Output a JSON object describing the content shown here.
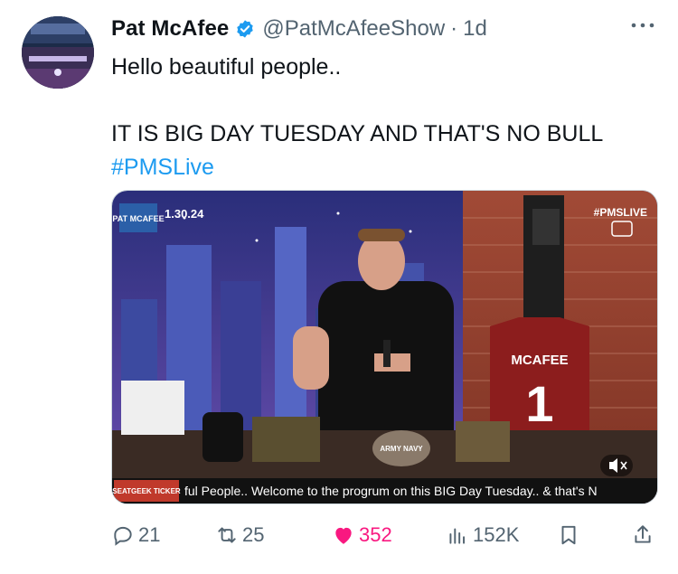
{
  "tweet": {
    "author_name": "Pat McAfee",
    "handle": "@PatMcAfeeShow",
    "separator": "·",
    "time": "1d",
    "text_line1": "Hello beautiful people..",
    "text_line2": "IT IS BIG DAY TUESDAY AND THAT'S NO BULL",
    "hashtag": "#PMSLive",
    "verified_color": "#1d9bf0"
  },
  "video": {
    "show_logo": "PAT MCAFEE",
    "date": "1.30.24",
    "corner_tag": "#PMSLIVE",
    "jersey_name": "MCAFEE",
    "jersey_number": "1",
    "ticker_brand": "SEATGEEK TICKER",
    "ticker_text": "ful People.. Welcome to the progrum on this BIG Day Tuesday.. & that's N",
    "helmet_text": "ARMY NAVY",
    "mute_icon": "speaker-muted-icon",
    "cc_icon": "closed-captions-icon"
  },
  "actions": {
    "replies": "21",
    "reposts": "25",
    "likes": "352",
    "views": "152K",
    "like_color": "#f91880"
  }
}
